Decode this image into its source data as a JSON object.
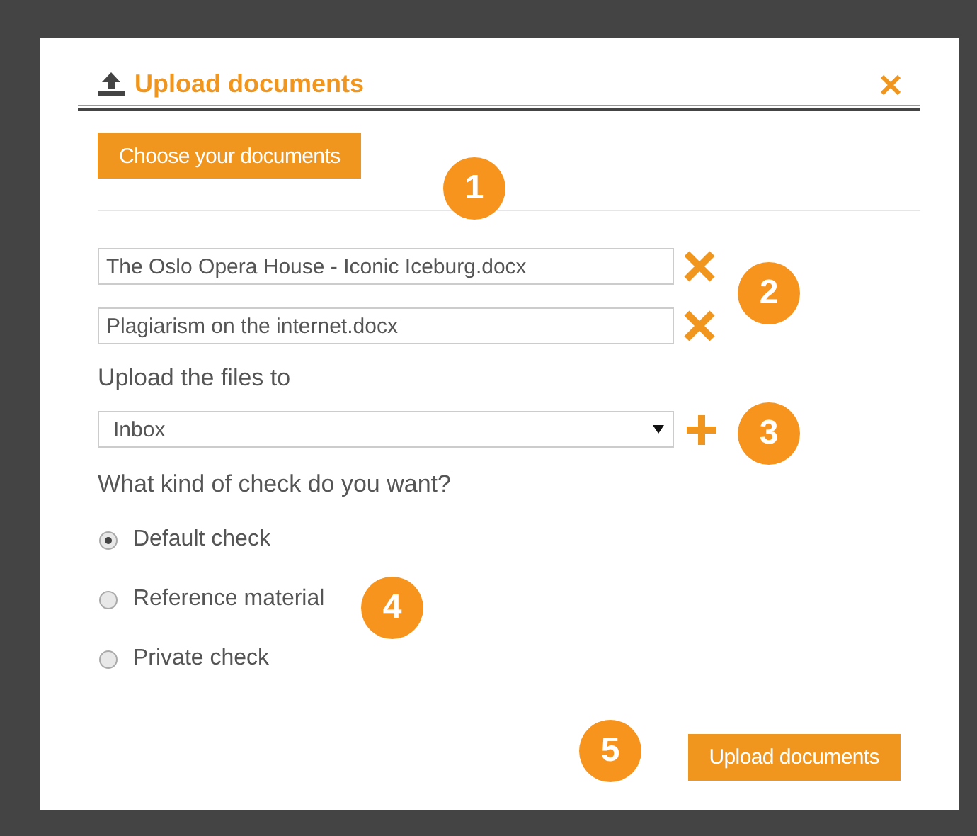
{
  "dialog": {
    "title": "Upload documents",
    "choose_button": "Choose your documents",
    "files": [
      {
        "name": "The Oslo Opera House - Iconic Iceburg.docx"
      },
      {
        "name": "Plagiarism on the internet.docx"
      }
    ],
    "destination": {
      "label": "Upload the files to",
      "value": "Inbox"
    },
    "check": {
      "label": "What kind of check do you want?",
      "options": [
        {
          "label": "Default check",
          "selected": true
        },
        {
          "label": "Reference material",
          "selected": false
        },
        {
          "label": "Private check",
          "selected": false
        }
      ]
    },
    "submit_button": "Upload documents"
  },
  "callouts": [
    "1",
    "2",
    "3",
    "4",
    "5"
  ]
}
